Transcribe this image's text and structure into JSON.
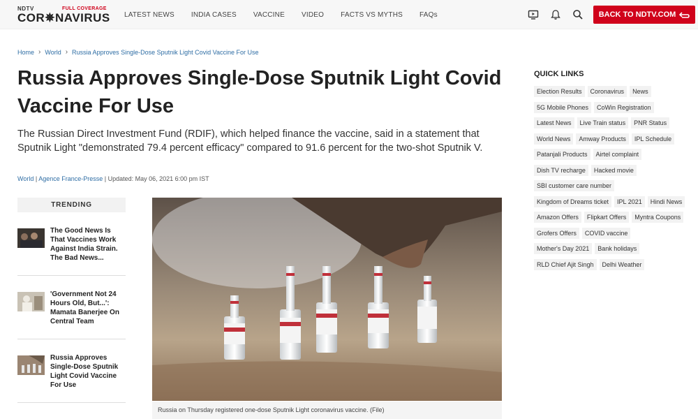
{
  "logo": {
    "top": "NDTV",
    "badge": "FULL COVERAGE",
    "main": "COR✵NAVIRUS"
  },
  "nav": [
    "LATEST NEWS",
    "INDIA CASES",
    "VACCINE",
    "VIDEO",
    "FACTS VS MYTHS",
    "FAQs"
  ],
  "header_actions": {
    "back_label": "BACK TO NDTV.COM"
  },
  "breadcrumb": [
    "Home",
    "World",
    "Russia Approves Single-Dose Sputnik Light Covid Vaccine For Use"
  ],
  "article": {
    "title": "Russia Approves Single-Dose Sputnik Light Covid Vaccine For Use",
    "summary": "The Russian Direct Investment Fund (RDIF), which helped finance the vaccine, said in a statement that Sputnik Light \"demonstrated 79.4 percent efficacy\" compared to 91.6 percent for the two-shot Sputnik V.",
    "meta_section": "World",
    "meta_source": "Agence France-Presse",
    "meta_updated": "Updated: May 06, 2021 6:00 pm IST",
    "caption": "Russia on Thursday registered one-dose Sputnik Light coronavirus vaccine. (File)"
  },
  "trending": {
    "heading": "TRENDING",
    "items": [
      "The Good News Is That Vaccines Work Against India Strain. The Bad News...",
      "'Government Not 24 Hours Old, But...': Mamata Banerjee On Central Team",
      "Russia Approves Single-Dose Sputnik Light Covid Vaccine For Use"
    ]
  },
  "quick_links": {
    "heading": "QUICK LINKS",
    "tags": [
      "Election Results",
      "Coronavirus",
      "News",
      "5G Mobile Phones",
      "CoWin Registration",
      "Latest News",
      "Live Train status",
      "PNR Status",
      "World News",
      "Amway Products",
      "IPL Schedule",
      "Patanjali Products",
      "Airtel complaint",
      "Dish TV recharge",
      "Hacked movie",
      "SBI customer care number",
      "Kingdom of Dreams ticket",
      "IPL 2021",
      "Hindi News",
      "Amazon Offers",
      "Flipkart Offers",
      "Myntra Coupons",
      "Grofers Offers",
      "COVID vaccine",
      "Mother's Day 2021",
      "Bank holidays",
      "RLD Chief Ajit Singh",
      "Delhi Weather"
    ]
  },
  "colors": {
    "brand_red": "#d0021b",
    "link_blue": "#2e6da4"
  }
}
